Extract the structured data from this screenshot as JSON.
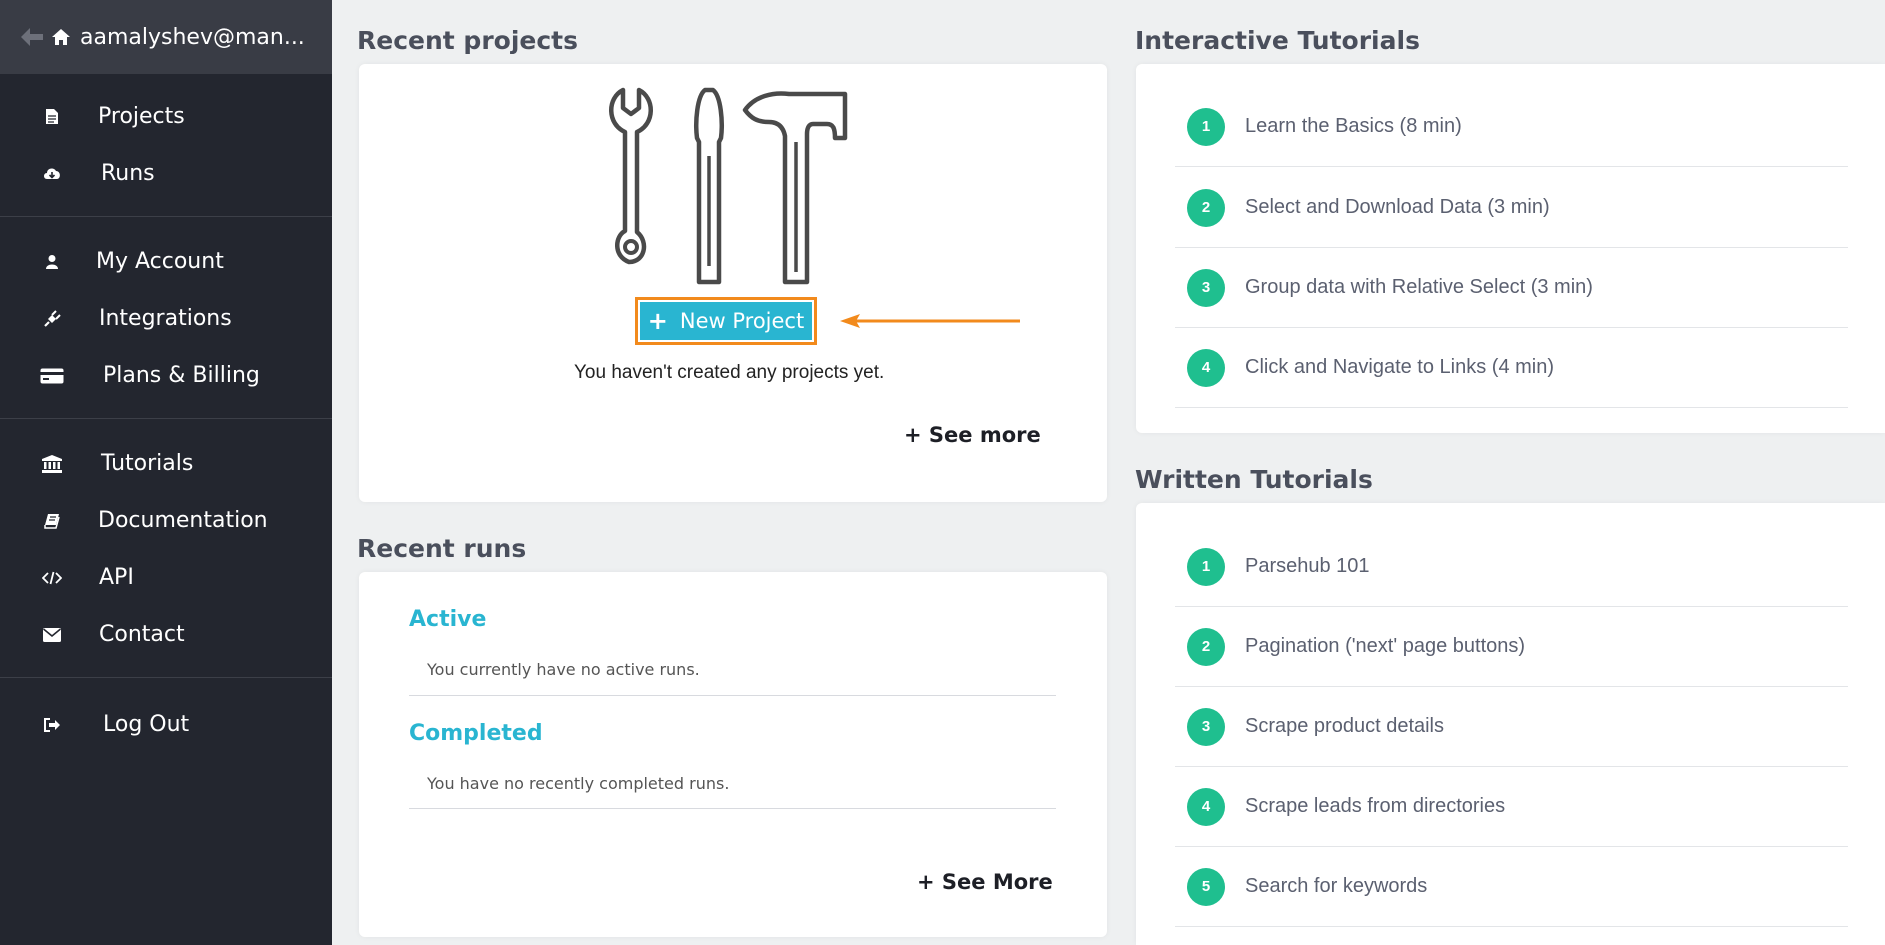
{
  "sidebar": {
    "user": "aamalyshev@man...",
    "groups": [
      [
        {
          "label": "Projects",
          "icon": "file-icon"
        },
        {
          "label": "Runs",
          "icon": "cloud-download-icon"
        }
      ],
      [
        {
          "label": "My Account",
          "icon": "user-icon"
        },
        {
          "label": "Integrations",
          "icon": "plug-icon"
        },
        {
          "label": "Plans & Billing",
          "icon": "credit-card-icon"
        }
      ],
      [
        {
          "label": "Tutorials",
          "icon": "institution-icon"
        },
        {
          "label": "Documentation",
          "icon": "book-icon"
        },
        {
          "label": "API",
          "icon": "code-icon"
        },
        {
          "label": "Contact",
          "icon": "envelope-icon"
        }
      ],
      [
        {
          "label": "Log Out",
          "icon": "sign-out-icon"
        }
      ]
    ]
  },
  "recent_projects": {
    "title": "Recent projects",
    "new_project_label": "New Project",
    "empty_text": "You haven't created any projects yet.",
    "see_more": "See more"
  },
  "recent_runs": {
    "title": "Recent runs",
    "active_title": "Active",
    "active_msg": "You currently have no active runs.",
    "completed_title": "Completed",
    "completed_msg": "You have no recently completed runs.",
    "see_more": "See More"
  },
  "interactive_tutorials": {
    "title": "Interactive Tutorials",
    "items": [
      {
        "num": "1",
        "label": "Learn the Basics (8 min)"
      },
      {
        "num": "2",
        "label": "Select and Download Data (3 min)"
      },
      {
        "num": "3",
        "label": "Group data with Relative Select (3 min)"
      },
      {
        "num": "4",
        "label": "Click and Navigate to Links (4 min)"
      }
    ]
  },
  "written_tutorials": {
    "title": "Written Tutorials",
    "items": [
      {
        "num": "1",
        "label": "Parsehub 101"
      },
      {
        "num": "2",
        "label": "Pagination ('next' page buttons)"
      },
      {
        "num": "3",
        "label": "Scrape product details"
      },
      {
        "num": "4",
        "label": "Scrape leads from directories"
      },
      {
        "num": "5",
        "label": "Search for keywords"
      }
    ]
  },
  "colors": {
    "sidebar_bg": "#23262f",
    "accent": "#29b5d1",
    "tutorial_badge": "#1fbf8f",
    "highlight": "#f28a1c"
  }
}
